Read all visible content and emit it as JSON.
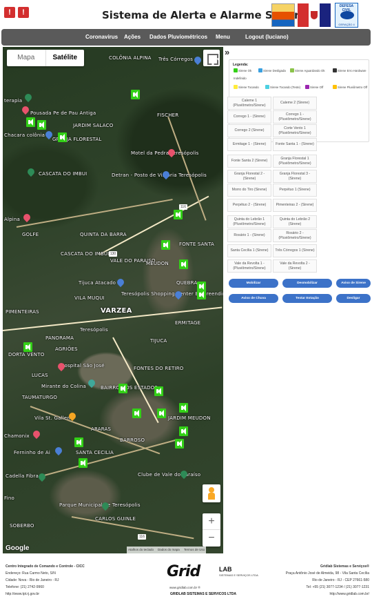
{
  "header": {
    "title": "Sistema de Alerta e Alarme Sonoro",
    "logo_defesa": "defesa-civil-teresopolis-logo",
    "logo_civil_top": "DEFESA CIVIL",
    "logo_civil_bottom": "GERAÇÃO 4"
  },
  "nav": {
    "items": [
      "Coronavirus",
      "Ações",
      "Dados Pluviométricos",
      "Menu",
      "Logout (luciano)"
    ]
  },
  "map": {
    "toggle_map": "Mapa",
    "toggle_satellite": "Satélite",
    "google": "Google",
    "attrib_1": "Atalhos do teclado",
    "attrib_2": "Dados do mapa",
    "attrib_3": "Termos de Uso",
    "zoom_in": "+",
    "zoom_out": "−",
    "labels": {
      "colonia_alpina": "COLÔNIA ALPINA",
      "tres_corregos": "Três Córregos",
      "terapia": "terapia",
      "pousada": "Pousada Pe de Pau Antiga",
      "jardim_salaco": "JARDIM SALACO",
      "fischer": "FISCHER",
      "chacara": "Chacara colônia",
      "granja": "GRANJA FLORESTAL",
      "motel": "Motel da Pedra Teresópolis",
      "cascata": "CASCATA DO IMBUI",
      "detran": "Detran - Posto de Vistoria Teresópolis",
      "alpina": "Alpina",
      "golfe": "GOLFE",
      "quinta": "QUINTA DA BARRA",
      "fonte_santa": "FONTE SANTA",
      "cascata_imbui": "CASCATA DO IMBUI",
      "vale_paraiso": "VALE DO PARAISO",
      "meudon": "MEUDON",
      "quebra": "QUEBRA",
      "tijuca_atacado": "Tijuca Atacado",
      "vila_muqui": "VILA MUQUI",
      "shopping": "Teresópolis Shopping Center Empreendimentos",
      "pimenteiras": "PIMENTEIRAS",
      "varzea": "VARZEA",
      "ermitage": "ERMITAGE",
      "teresopolis": "Teresópolis",
      "panorama": "PANORAMA",
      "tijuca": "TIJUCA",
      "dorta": "DORTA VENTO",
      "agriões": "AGRIÕES",
      "hospital": "Hospital São José",
      "lucas": "LUCAS",
      "fontes_retiro": "FONTES DO RETIRO",
      "mirante": "Mirante do Colina",
      "taumaturgo": "TAUMATURGO",
      "bairro": "BAIRRO DOS ESTADOS",
      "vila_st_gallen": "Vila St. Gallen",
      "jardim_meudon": "JARDIM MEUDON",
      "araras": "ARARAS",
      "barroso": "BARROSO",
      "chamonix": "Chamonix",
      "ferninho": "Ferninho de Ai",
      "santa_cecilia": "SANTA CECILIA",
      "cadella": "Cadella Fibra",
      "fino": "Fino",
      "parque": "Parque Municipal de Teresópolis",
      "clube": "Clube de Vale do Paraíso",
      "carlos_guinle": "CARLOS GUINLE",
      "sobradinho": "SOBERBO"
    }
  },
  "legend": {
    "title": "Legenda:",
    "items": [
      {
        "label": "Sirene Ok",
        "color": "#33d017"
      },
      {
        "label": "Sirene Desligada",
        "color": "#3aa0e0"
      },
      {
        "label": "Sirene Aguardando Ok",
        "color": "#8bc34a"
      },
      {
        "label": "Sirene Erro Hardware",
        "color": "#333333"
      },
      {
        "label": "Indefinido",
        "color": "#9e9e9e"
      },
      {
        "label": "Sirene Tocando",
        "color": "#ffeb3b"
      },
      {
        "label": "Sirene Tocando (Teste)",
        "color": "#4dd0e1"
      },
      {
        "label": "Sirene Off",
        "color": "#9c27b0"
      },
      {
        "label": "Sirene Pluviômetro Off",
        "color": "#ffc107"
      }
    ]
  },
  "sirens": [
    "Caleme 1 (Pluviômetro/Sirene)",
    "Caleme 2 (Sirene)",
    "Corrego 1 - (Sirene)",
    "Corrego 1 - (Pluviômetro/Sirene)",
    "Corrego 2 (Sirene)",
    "Corte Vento 1 (Pluviômetro/Sirene)",
    "Ermitage 1 - (Sirene)",
    "Fonte Santa 1 - (Sirene)",
    "Fonte Santa 2 (Sirene)",
    "Granja Florestal 1 (Pluviômetro/Sirene)",
    "Granja Florestal 2 - (Sirene)",
    "Granja Florestal 3 - (Sirene)",
    "Morro do Tiro (Sirene)",
    "Perpétuo 1 (Sirene)",
    "Perpétuo 2 - (Sirene)",
    "Pimenteiras 2 - (Sirene)",
    "Quinta do Lebrão 1 (Pluviômetro/Sirene)",
    "Quinta do Lebrão 2 (Sirene)",
    "Rosário 1 - (Sirene)",
    "Rosário 2 - (Pluviômetro/Sirene)",
    "Santa Cecília 1 (Sirene)",
    "Três Córregos 1 (Sirene)",
    "Vale da Revolta 1 - (Pluviômetro/Sirene)",
    "Vale da Revolta 2 - (Sirene)"
  ],
  "buttons": {
    "row1": [
      "Mobilizar",
      "Desmobilizar",
      "Aviso de Sirene"
    ],
    "row2": [
      "Aviso de Chuva",
      "Testar Estação",
      "Desligar"
    ]
  },
  "footer": {
    "left_1": "Centro Integrado de Comando e Controle - CICC",
    "left_2": "Endereço: Rua Carmo Neto, S/N",
    "left_3": "Cidade: Nova - Rio de Janeiro - RJ",
    "left_4": "Telefone: (21) 2742-9960",
    "left_5": "http://www.tpt.rj.gov.br",
    "logo": "Grid",
    "lab": "LAB",
    "lab_sub": "SISTEMAS E SERVIÇOS LTDA",
    "url": "www.gridlab.com.br ®",
    "company": "GRIDLAB SISTEMAS E SERVICOS LTDA",
    "right_1": "Gridlab Sistemas e Serviços®",
    "right_2": "Praça Antônio José de Almeida, 98 - Vila Santa Cecília",
    "right_3": "Rio de Janeiro - RJ - CEP 27661-580",
    "right_4": "Tel: +55 (21) 3077-1234 / (21) 3077-1231",
    "right_5": "http://www.gridlab.com.br/"
  }
}
